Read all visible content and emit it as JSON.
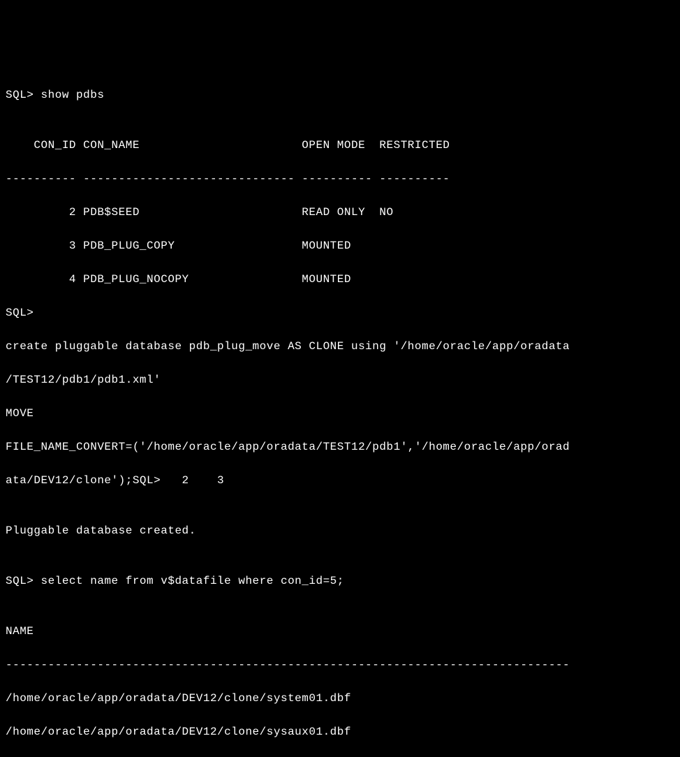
{
  "lines": {
    "l0": "SQL> show pdbs",
    "l1": "",
    "l2": "    CON_ID CON_NAME                       OPEN MODE  RESTRICTED",
    "l3": "---------- ------------------------------ ---------- ----------",
    "l4": "         2 PDB$SEED                       READ ONLY  NO",
    "l5": "         3 PDB_PLUG_COPY                  MOUNTED",
    "l6": "         4 PDB_PLUG_NOCOPY                MOUNTED",
    "l7": "SQL>",
    "l8": "create pluggable database pdb_plug_move AS CLONE using '/home/oracle/app/oradata",
    "l9": "/TEST12/pdb1/pdb1.xml'",
    "l10": "MOVE",
    "l11": "FILE_NAME_CONVERT=('/home/oracle/app/oradata/TEST12/pdb1','/home/oracle/app/orad",
    "l12": "ata/DEV12/clone');SQL>   2    3",
    "l13": "",
    "l14": "Pluggable database created.",
    "l15": "",
    "l16": "SQL> select name from v$datafile where con_id=5;",
    "l17": "",
    "l18": "NAME",
    "l19": "--------------------------------------------------------------------------------",
    "l20": "/home/oracle/app/oradata/DEV12/clone/system01.dbf",
    "l21": "/home/oracle/app/oradata/DEV12/clone/sysaux01.dbf"
  }
}
